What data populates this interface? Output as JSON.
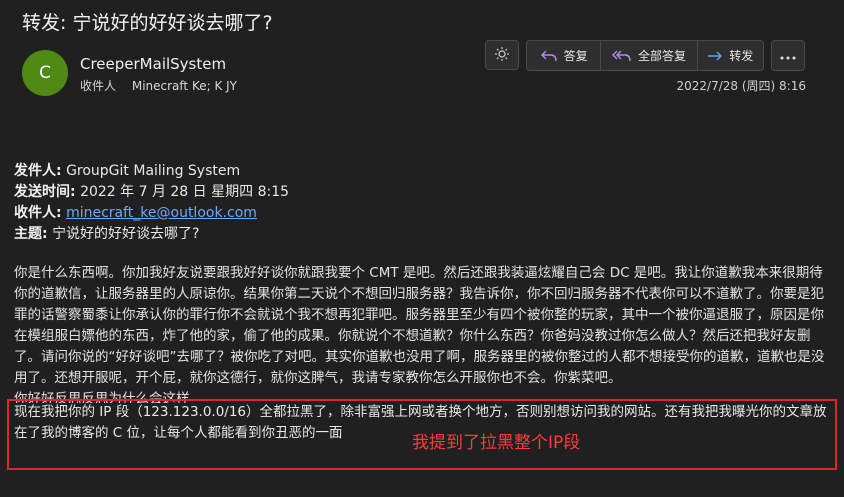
{
  "email": {
    "subject": "转发: 宁说好的好好谈去哪了?",
    "avatar_initial": "C",
    "sender_name": "CreeperMailSystem",
    "recipients_label": "收件人",
    "recipients_value": "Minecraft Ke; K JY",
    "date": "2022/7/28 (周四) 8:16"
  },
  "toolbar": {
    "theme_icon": "sun-icon",
    "reply_label": "答复",
    "reply_all_label": "全部答复",
    "forward_label": "转发",
    "more_icon": "more-horizontal-icon"
  },
  "forwarded_header": {
    "from_label": "发件人:",
    "from_value": "GroupGit Mailing System",
    "sent_label": "发送时间:",
    "sent_value": "2022 年 7 月 28 日 星期四 8:15",
    "to_label": "收件人:",
    "to_value": "minecraft_ke@outlook.com",
    "subject_label": "主题:",
    "subject_value": "宁说好的好好谈去哪了?"
  },
  "body": {
    "paragraph": "你是什么东西啊。你加我好友说要跟我好好谈你就跟我要个 CMT 是吧。然后还跟我装逼炫耀自己会 DC 是吧。我让你道歉我本来很期待你的道歉信，让服务器里的人原谅你。结果你第二天说个不想回归服务器？我告诉你，你不回归服务器不代表你可以不道歉了。你要是犯罪的话警察蜀黍让你承认你的罪行你不会就说个我不想再犯罪吧。服务器里至少有四个被你整的玩家，其中一个被你逼退服了，原因是你在模组服白嫖他的东西，炸了他的家，偷了他的成果。你就说个不想道歉？你什么东西？你爸妈没教过你怎么做人？然后还把我好友删了。请问你说的“好好谈吧”去哪了？被你吃了对吧。其实你道歉也没用了啊，服务器里的被你整过的人都不想接受你的道歉，道歉也是没用了。还想开服呢，开个屁，就你这德行，就你这脾气，我请专家教你怎么开服你也不会。你紫菜吧。",
    "partial_line": "你好好反思反思为什么会这样",
    "ban_notice": "现在我把你的 IP 段（123.123.0.0/16）全都拉黑了，除非富强上网或者换个地方，否则别想访问我的网站。还有我把我曝光你的文章放在了我的博客的 C 位，让每个人都能看到你丑恶的一面"
  },
  "annotation": {
    "text": "我提到了拉黑整个IP段",
    "color": "#e0262b"
  }
}
